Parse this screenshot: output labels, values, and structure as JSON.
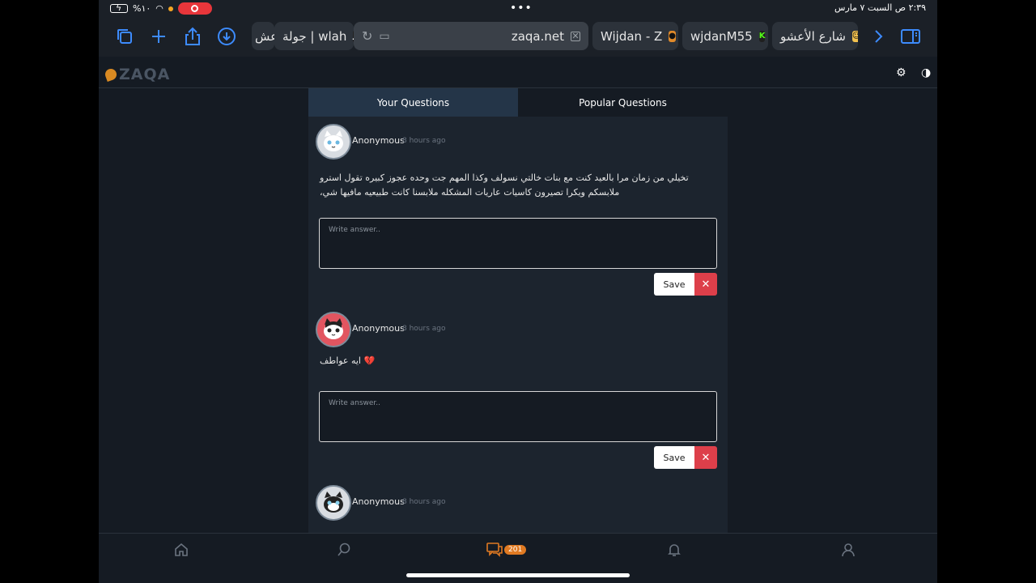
{
  "status_bar": {
    "battery": "%١٠",
    "dots": "•••",
    "datetime": "٢:٣٩ ص   السبت ٧ مارس"
  },
  "toolbar": {
    "icons": [
      "tabs-overview-icon",
      "new-tab-icon",
      "share-icon",
      "download-icon",
      "forward-icon",
      "sidebar-icon"
    ],
    "tabs": [
      {
        "label": "عش",
        "active": false
      },
      {
        "label": "جولة | wlah",
        "active": false
      },
      {
        "label": "zaqa.net",
        "active": true
      },
      {
        "label": "Wijdan - Z",
        "active": false
      },
      {
        "label": "wjdanM55",
        "active": false
      },
      {
        "label": "شارع الأعشو",
        "active": false
      }
    ]
  },
  "app": {
    "logo_text": "ZAQA",
    "tabs": {
      "yours": "Your Questions",
      "popular": "Popular Questions"
    },
    "questions": [
      {
        "user": "Anonymous",
        "time": "8 hours ago",
        "text": "تخيلي من زمان مرا بالعيد كنت مع بنات خالتي نسولف وكذا المهم جت وحده عجوز كبيره تقول استرو ملابسكم ويكرا تصيرون كاسيات عاريات المشكله ملابسنا كانت طبيعيه مافيها شي،",
        "placeholder": "Write answer..",
        "save": "Save",
        "avatar_color": "#c8ccd2"
      },
      {
        "user": "Anonymous",
        "time": "8 hours ago",
        "text": "💔 ايه عواطف",
        "placeholder": "Write answer..",
        "save": "Save",
        "avatar_color": "#e25560"
      },
      {
        "user": "Anonymous",
        "time": "8 hours ago",
        "text": "",
        "placeholder": "",
        "save": "",
        "avatar_color": "#c8ccd2"
      }
    ],
    "bottom_nav": {
      "badge": "201"
    },
    "close_symbol": "✕"
  }
}
